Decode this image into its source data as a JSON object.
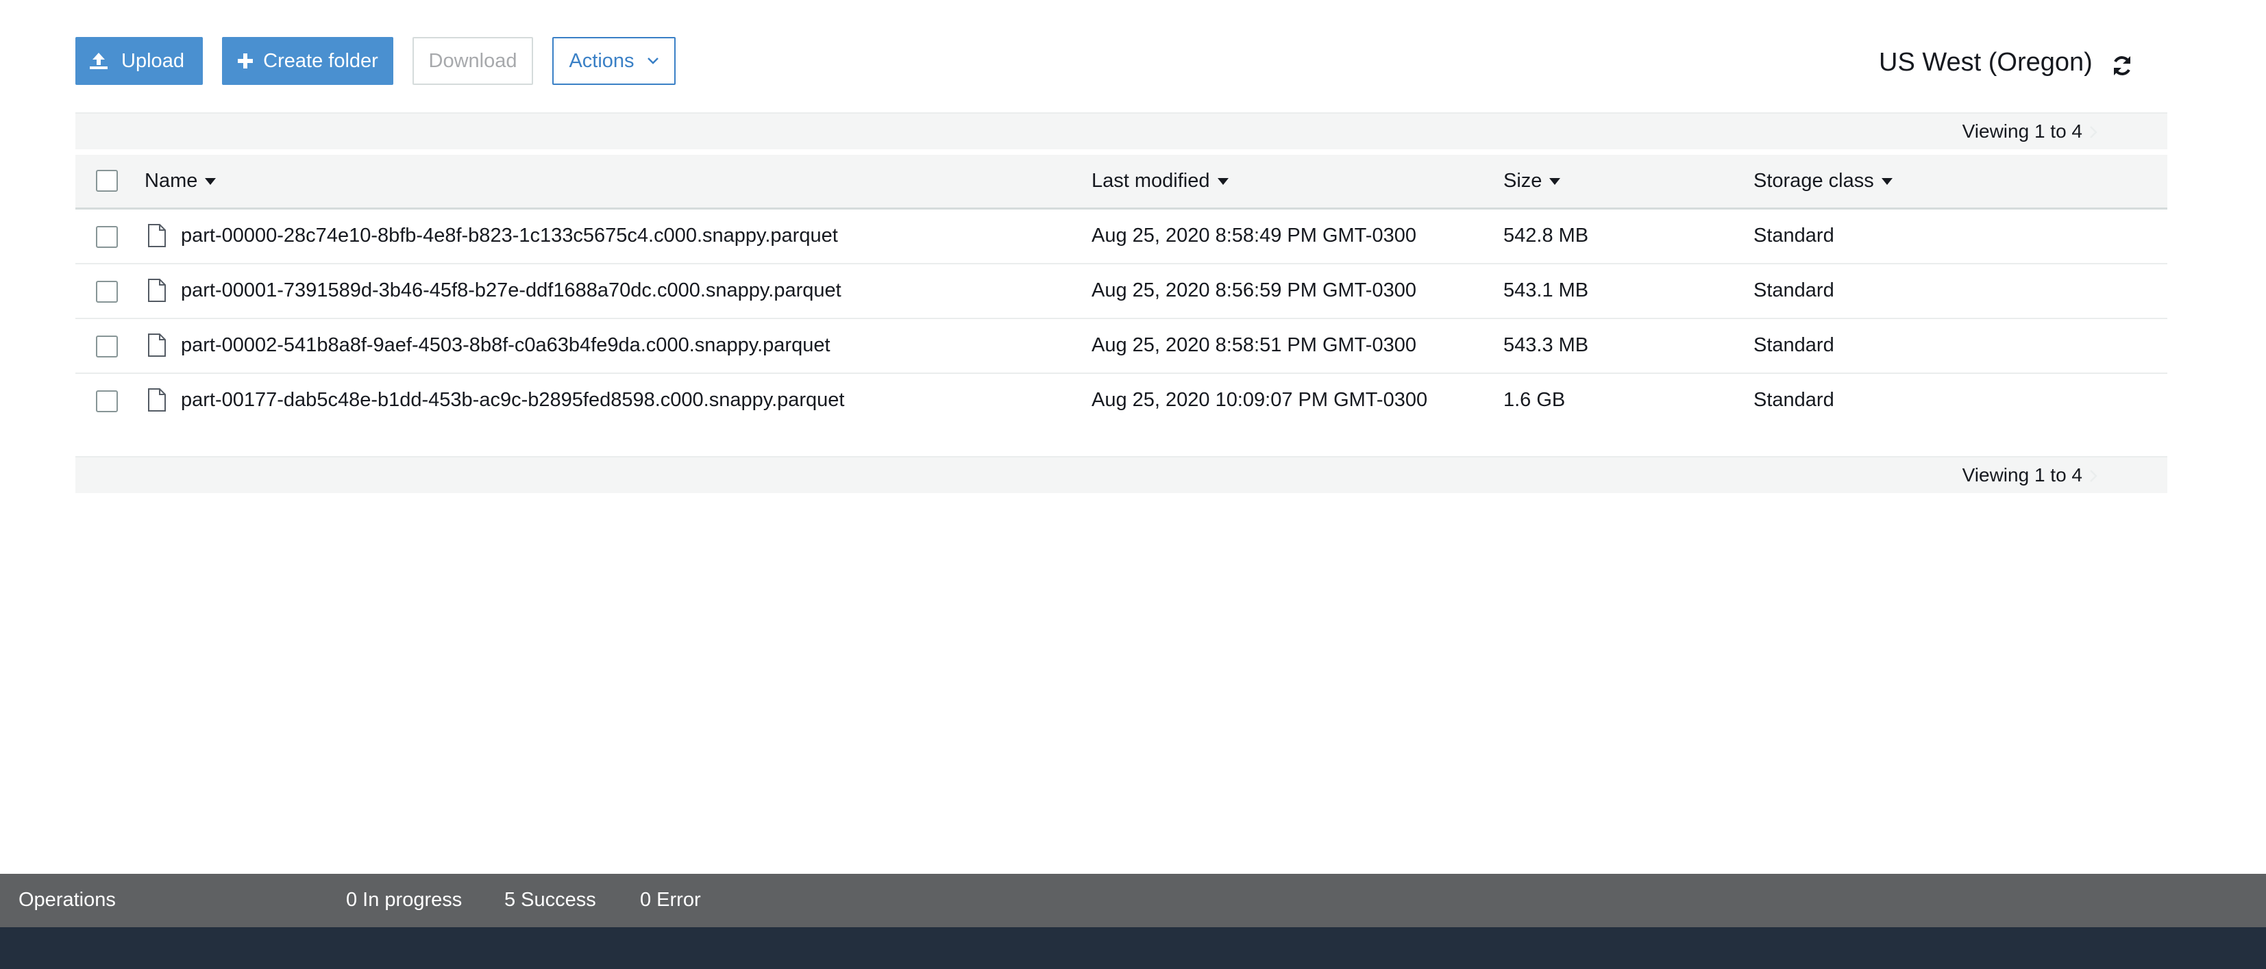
{
  "toolbar": {
    "upload_label": "Upload",
    "create_folder_label": "Create folder",
    "download_label": "Download",
    "actions_label": "Actions"
  },
  "region": {
    "label": "US West (Oregon)"
  },
  "pagination": {
    "viewing_label": "Viewing 1 to 4"
  },
  "table": {
    "columns": {
      "name": "Name",
      "last_modified": "Last modified",
      "size": "Size",
      "storage_class": "Storage class"
    },
    "rows": [
      {
        "name": "part-00000-28c74e10-8bfb-4e8f-b823-1c133c5675c4.c000.snappy.parquet",
        "last_modified": "Aug 25, 2020 8:58:49 PM GMT-0300",
        "size": "542.8 MB",
        "storage_class": "Standard"
      },
      {
        "name": "part-00001-7391589d-3b46-45f8-b27e-ddf1688a70dc.c000.snappy.parquet",
        "last_modified": "Aug 25, 2020 8:56:59 PM GMT-0300",
        "size": "543.1 MB",
        "storage_class": "Standard"
      },
      {
        "name": "part-00002-541b8a8f-9aef-4503-8b8f-c0a63b4fe9da.c000.snappy.parquet",
        "last_modified": "Aug 25, 2020 8:58:51 PM GMT-0300",
        "size": "543.3 MB",
        "storage_class": "Standard"
      },
      {
        "name": "part-00177-dab5c48e-b1dd-453b-ac9c-b2895fed8598.c000.snappy.parquet",
        "last_modified": "Aug 25, 2020 10:09:07 PM GMT-0300",
        "size": "1.6 GB",
        "storage_class": "Standard"
      }
    ]
  },
  "operations": {
    "title": "Operations",
    "in_progress": "0 In progress",
    "success": "5 Success",
    "error": "0 Error"
  },
  "icons": {
    "upload": "upload-icon",
    "create_folder": "plus-icon",
    "actions": "chevron-down-icon",
    "refresh": "refresh-icon",
    "sort": "caret-down-icon",
    "file": "file-icon",
    "pager_next": "chevron-right-icon"
  },
  "colors": {
    "primary": "#4a90d0",
    "link": "#3a80c6",
    "disabled_text": "#a7a9ac",
    "header_bg": "#f4f5f5",
    "operations_bar": "#5f6163",
    "footer": "#232f3e"
  }
}
